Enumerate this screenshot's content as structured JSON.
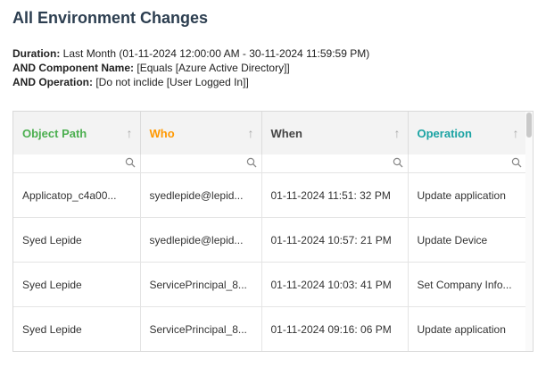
{
  "page": {
    "title": "All Environment Changes"
  },
  "filters": [
    {
      "label": "Duration:",
      "value": "Last Month (01-11-2024 12:00:00 AM - 30-11-2024 11:59:59 PM)"
    },
    {
      "label": "AND Component Name:",
      "value": "[Equals [Azure Active Directory]]"
    },
    {
      "label": "AND Operation:",
      "value": "[Do not inclide [User Logged In]]"
    }
  ],
  "table": {
    "columns": [
      {
        "label": "Object Path",
        "color": "#4caf50"
      },
      {
        "label": "Who",
        "color": "#ff9800"
      },
      {
        "label": "When",
        "color": "#444444"
      },
      {
        "label": "Operation",
        "color": "#1aa3a3"
      }
    ],
    "sort_icon": "arrow-up-icon",
    "filter_icon": "search-icon",
    "rows": [
      [
        "Applicatop_c4a00...",
        "syedlepide@lepid...",
        "01-11-2024 11:51: 32 PM",
        "Update application"
      ],
      [
        "Syed Lepide",
        "syedlepide@lepid...",
        "01-11-2024 10:57: 21 PM",
        "Update Device"
      ],
      [
        "Syed Lepide",
        "ServicePrincipal_8...",
        "01-11-2024 10:03: 41 PM",
        "Set Company Info..."
      ],
      [
        "Syed Lepide",
        "ServicePrincipal_8...",
        "01-11-2024 09:16: 06 PM",
        "Update application"
      ]
    ]
  }
}
